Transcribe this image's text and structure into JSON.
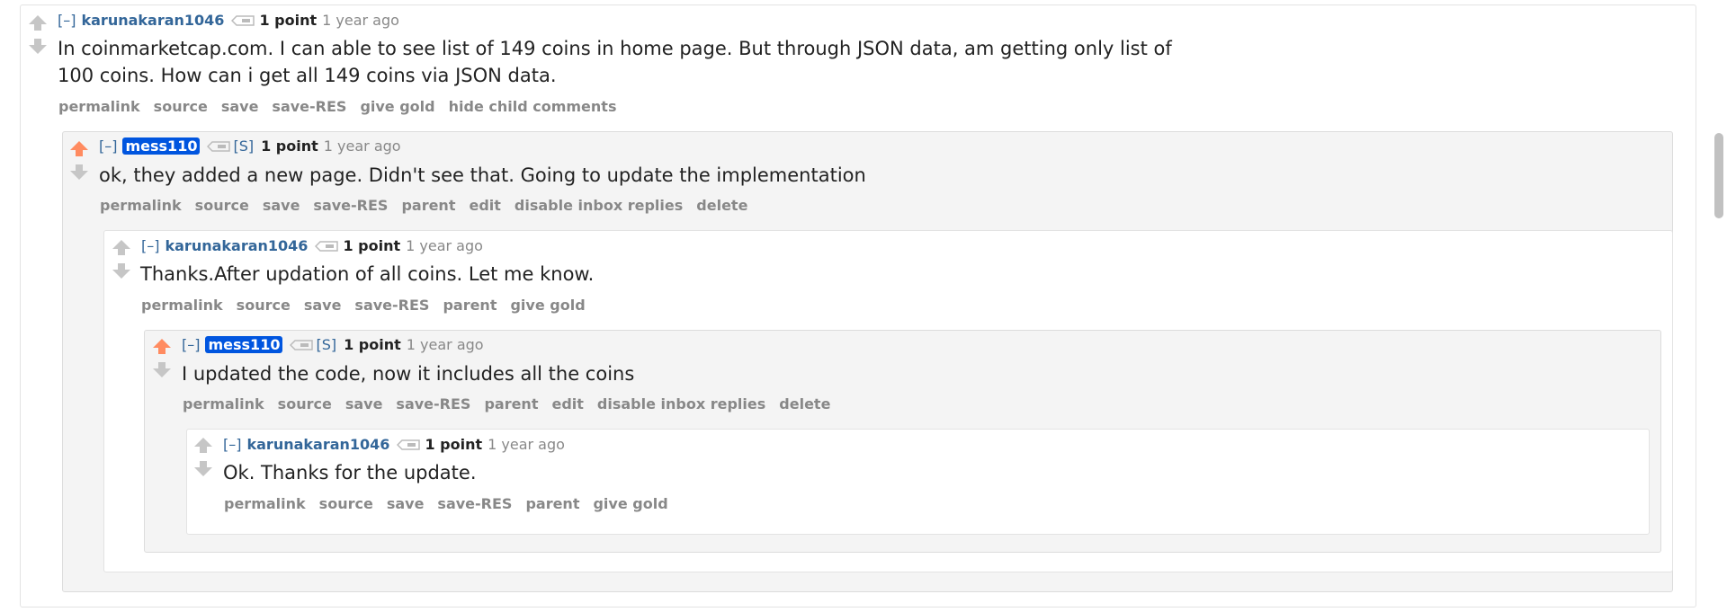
{
  "comments": [
    {
      "expand": "[–]",
      "author": "karunakaran1046",
      "score": "1 point",
      "time": "1 year ago",
      "body_line1": "In coinmarketcap.com. I can able to see list of 149 coins in home page. But through JSON data, am getting only list of",
      "body_line2": "100 coins. How can i get all 149 coins via JSON data.",
      "buttons": [
        "permalink",
        "source",
        "save",
        "save-RES",
        "give gold",
        "hide child comments"
      ]
    },
    {
      "expand": "[–]",
      "author": "mess110",
      "submitter": "[S]",
      "score": "1 point",
      "time": "1 year ago",
      "body_line1": "ok, they added a new page. Didn't see that. Going to update the implementation",
      "buttons": [
        "permalink",
        "source",
        "save",
        "save-RES",
        "parent",
        "edit",
        "disable inbox replies",
        "delete"
      ]
    },
    {
      "expand": "[–]",
      "author": "karunakaran1046",
      "score": "1 point",
      "time": "1 year ago",
      "body_line1": "Thanks.After updation of all coins. Let me know.",
      "buttons": [
        "permalink",
        "source",
        "save",
        "save-RES",
        "parent",
        "give gold"
      ]
    },
    {
      "expand": "[–]",
      "author": "mess110",
      "submitter": "[S]",
      "score": "1 point",
      "time": "1 year ago",
      "body_line1": "I updated the code, now it includes all the coins",
      "buttons": [
        "permalink",
        "source",
        "save",
        "save-RES",
        "parent",
        "edit",
        "disable inbox replies",
        "delete"
      ]
    },
    {
      "expand": "[–]",
      "author": "karunakaran1046",
      "score": "1 point",
      "time": "1 year ago",
      "body_line1": "Ok. Thanks for the update.",
      "buttons": [
        "permalink",
        "source",
        "save",
        "save-RES",
        "parent",
        "give gold"
      ]
    }
  ],
  "colors": {
    "upvoted": "#ff8b60",
    "arrow_default": "#c6c6c6",
    "author_link": "#336699",
    "op_badge": "#0055df"
  },
  "icons": {
    "upvote": "up-arrow-icon",
    "downvote": "down-arrow-icon",
    "tag": "tag-icon"
  }
}
